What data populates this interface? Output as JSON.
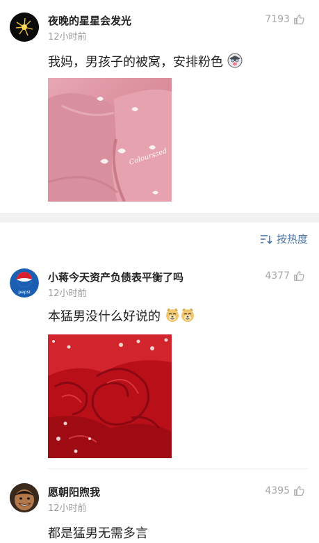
{
  "comments": [
    {
      "username": "夜晚的星星会发光",
      "time": "12小时前",
      "likes": "7193",
      "text": "我妈，男孩子的被窝，安排粉色",
      "image_text": "Colourssed"
    },
    {
      "username": "小蒋今天资产负债表平衡了吗",
      "time": "12小时前",
      "likes": "4377",
      "text": "本猛男没什么好说的",
      "avatar_text": "pepsi"
    },
    {
      "username": "愿朝阳煦我",
      "time": "12小时前",
      "likes": "4395",
      "text": "都是猛男无需多言"
    }
  ],
  "sort": {
    "label": "按热度"
  },
  "colors": {
    "accent": "#4a72a8",
    "muted": "#9a9a9a",
    "pink": "#d88a98",
    "red": "#c8161d"
  }
}
